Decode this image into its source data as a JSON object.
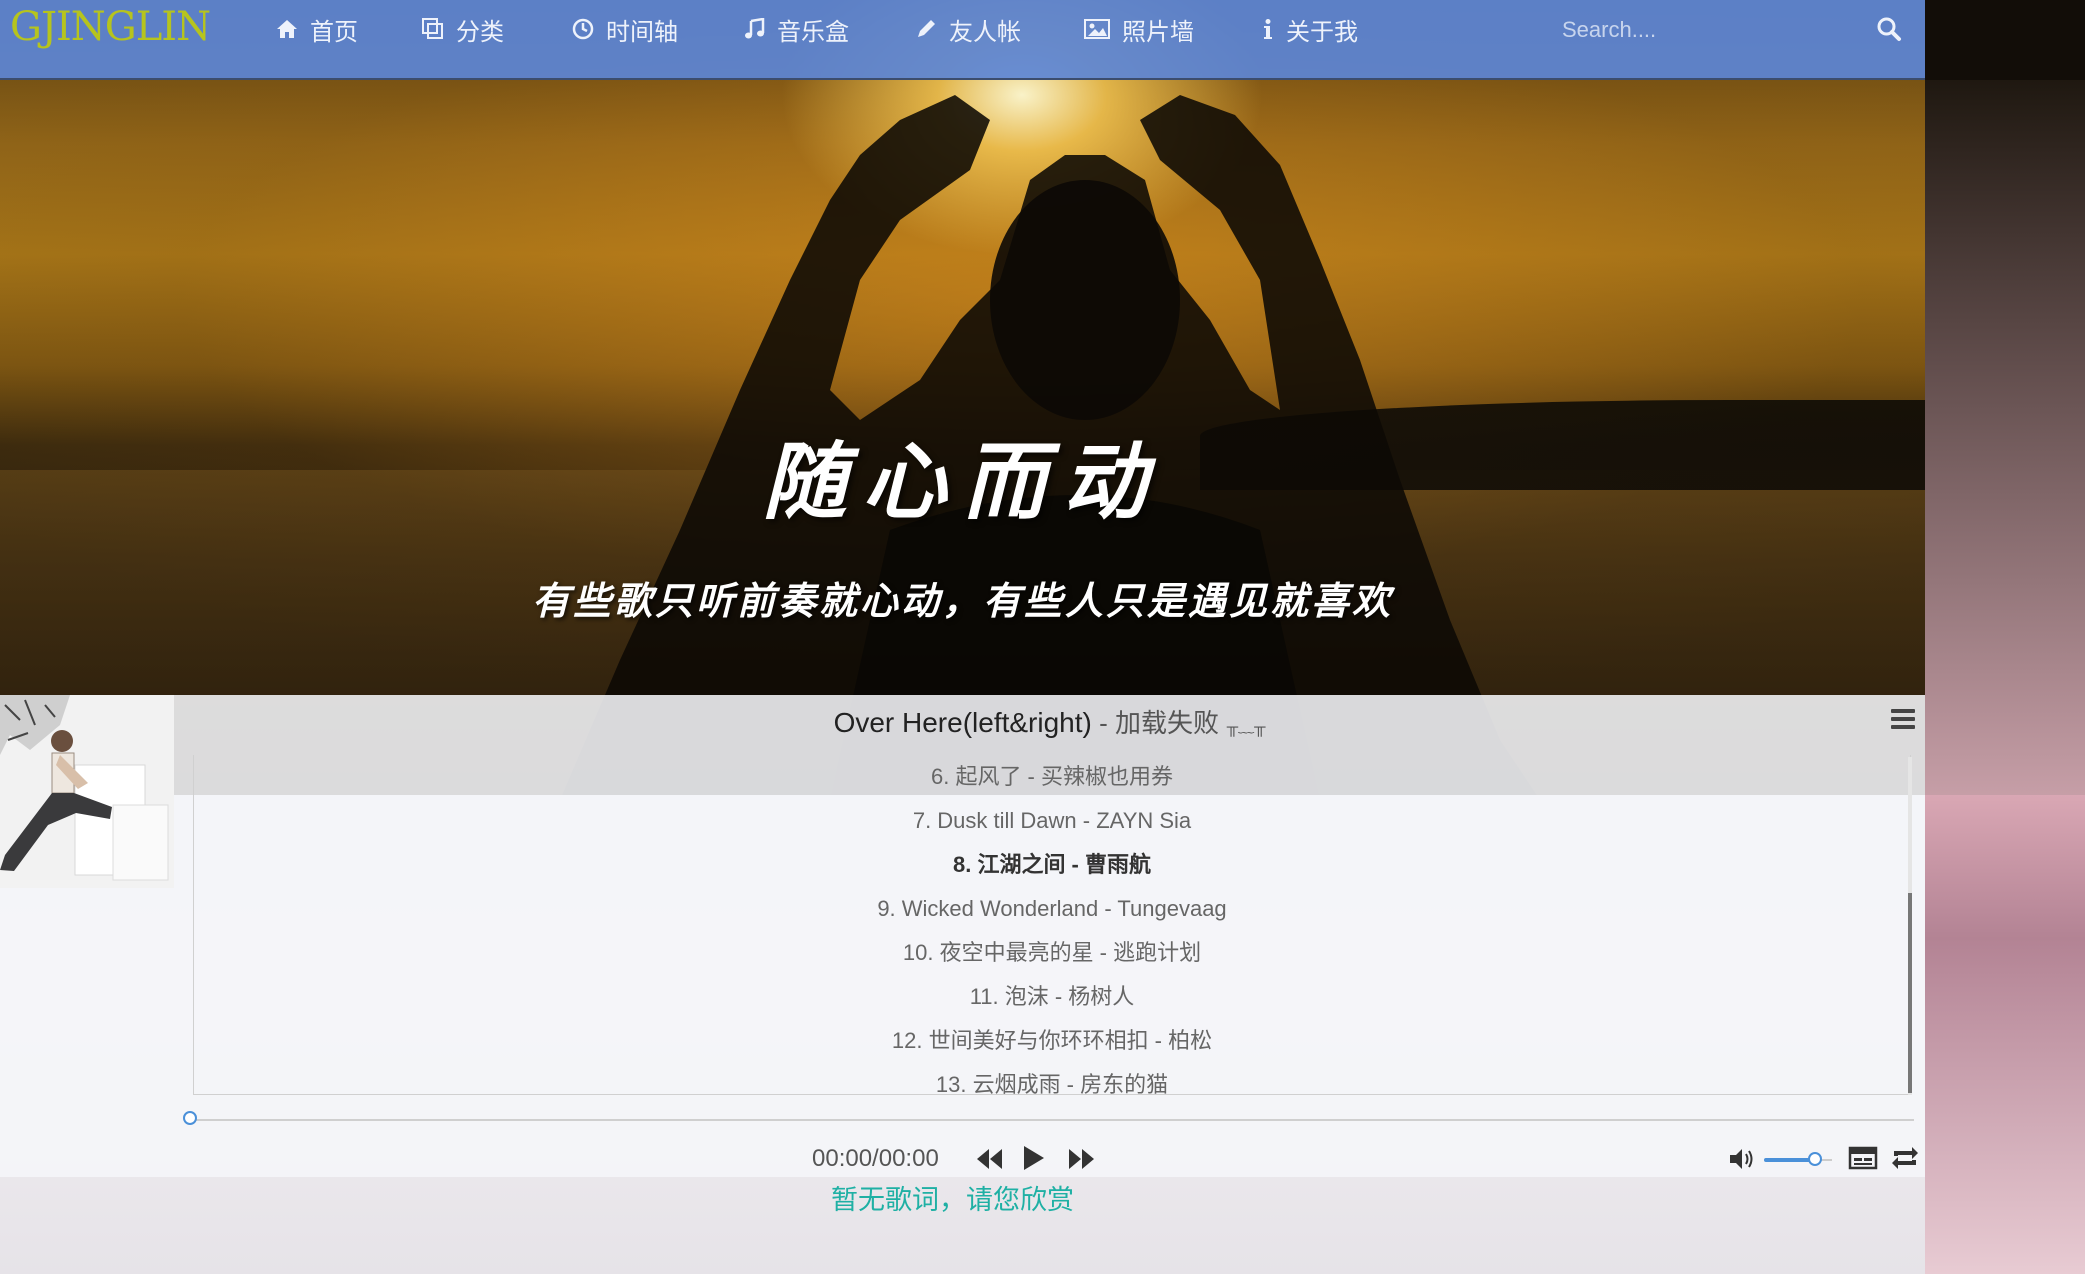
{
  "brand": "GJINGLIN",
  "nav": [
    {
      "label": "首页",
      "icon": "home-icon"
    },
    {
      "label": "分类",
      "icon": "copy-icon"
    },
    {
      "label": "时间轴",
      "icon": "clock-icon"
    },
    {
      "label": "音乐盒",
      "icon": "music-icon"
    },
    {
      "label": "友人帐",
      "icon": "pencil-icon"
    },
    {
      "label": "照片墙",
      "icon": "picture-icon"
    },
    {
      "label": "关于我",
      "icon": "info-icon"
    }
  ],
  "search": {
    "placeholder": "Search...."
  },
  "hero": {
    "title": "随心而动",
    "subtitle": "有些歌只听前奏就心动，有些人只是遇见就喜欢"
  },
  "player": {
    "now_playing_title": "Over Here(left&right)",
    "now_playing_artist": " - 加载失败",
    "now_playing_emote": "╥﹏╥",
    "tracks": [
      {
        "label": "6. 起风了  -  买辣椒也用券",
        "active": false
      },
      {
        "label": "7. Dusk till Dawn  -  ZAYN Sia",
        "active": false
      },
      {
        "label": "8. 江湖之间  -  曹雨航",
        "active": true
      },
      {
        "label": "9. Wicked Wonderland  -  Tungevaag",
        "active": false
      },
      {
        "label": "10. 夜空中最亮的星  -  逃跑计划",
        "active": false
      },
      {
        "label": "11. 泡沫  -  杨树人",
        "active": false
      },
      {
        "label": "12. 世间美好与你环环相扣  -  柏松",
        "active": false
      },
      {
        "label": "13. 云烟成雨  -  房东的猫",
        "active": false
      }
    ],
    "time": "00:00/00:00",
    "progress": 0,
    "volume": 0.75,
    "lyrics": "暂无歌词，请您欣赏"
  },
  "colors": {
    "navbar": "#5c86d6",
    "brand": "#b6c41d",
    "accent": "#4a90d9",
    "lyrics": "#1fb0a4"
  }
}
